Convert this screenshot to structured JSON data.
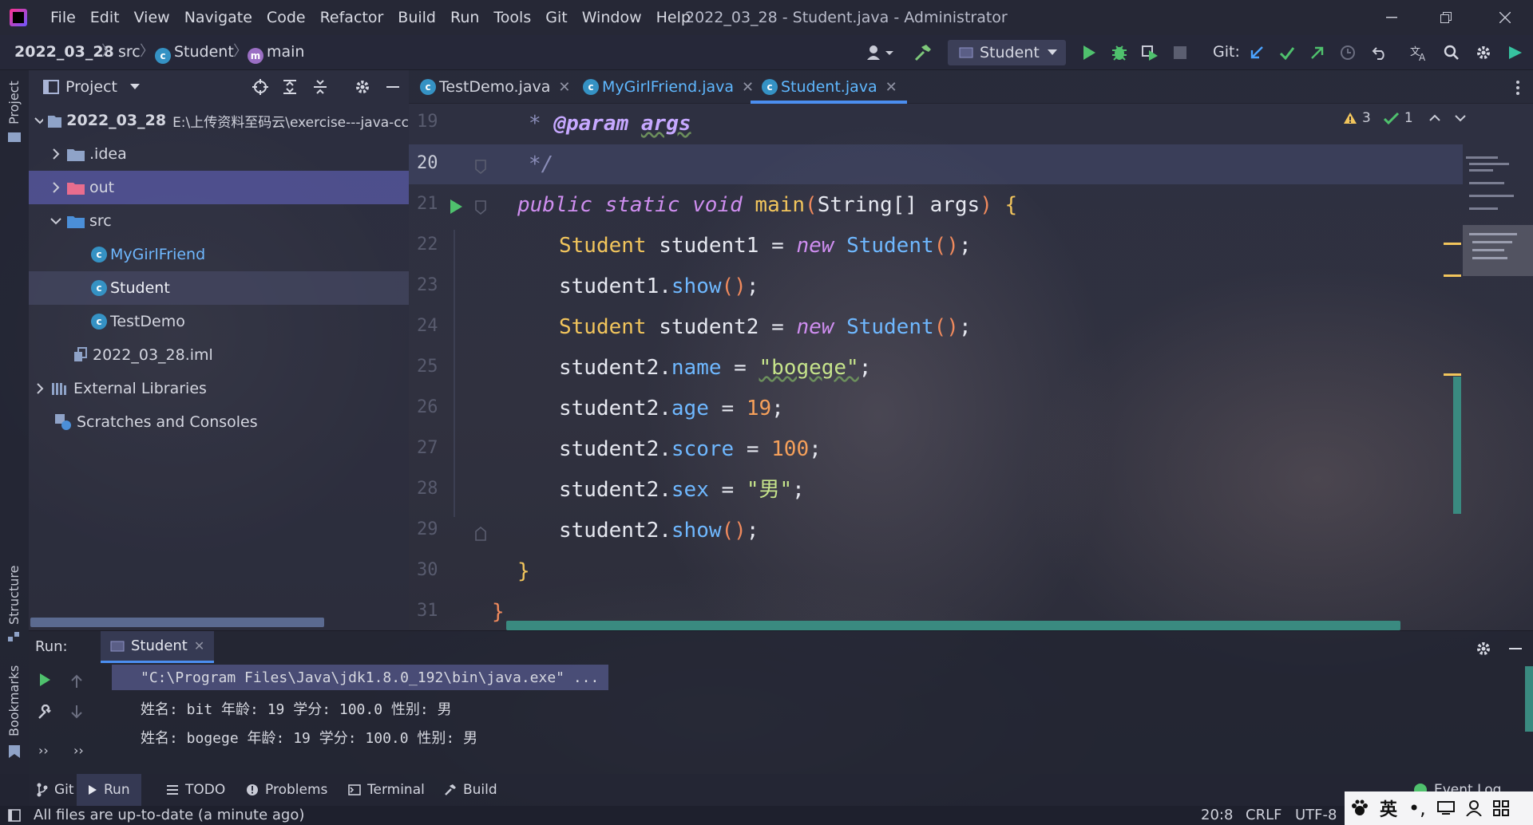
{
  "window": {
    "title": "2022_03_28 - Student.java - Administrator",
    "menu": [
      "File",
      "Edit",
      "View",
      "Navigate",
      "Code",
      "Refactor",
      "Build",
      "Run",
      "Tools",
      "Git",
      "Window",
      "Help"
    ]
  },
  "navbar": {
    "breadcrumb": {
      "project": "2022_03_28",
      "folder": "src",
      "class": "Student",
      "method": "main"
    },
    "run_config": "Student",
    "git_label": "Git:"
  },
  "side_stripe": {
    "project": "Project",
    "structure": "Structure",
    "bookmarks": "Bookmarks"
  },
  "project_panel": {
    "title": "Project",
    "tree": [
      {
        "label": "2022_03_28",
        "path": "E:\\上传资料至码云\\exercise---java-cc"
      },
      {
        "label": ".idea"
      },
      {
        "label": "out"
      },
      {
        "label": "src"
      },
      {
        "label": "MyGirlFriend"
      },
      {
        "label": "Student"
      },
      {
        "label": "TestDemo"
      },
      {
        "label": "2022_03_28.iml"
      },
      {
        "label": "External Libraries"
      },
      {
        "label": "Scratches and Consoles"
      }
    ]
  },
  "editor": {
    "tabs": [
      {
        "label": "TestDemo.java"
      },
      {
        "label": "MyGirlFriend.java"
      },
      {
        "label": "Student.java"
      }
    ],
    "inspection": {
      "warnings": "3",
      "ok": "1"
    },
    "line_numbers": [
      "19",
      "20",
      "21",
      "22",
      "23",
      "24",
      "25",
      "26",
      "27",
      "28",
      "29",
      "30",
      "31"
    ],
    "code": {
      "l19_star": "* ",
      "l19_tag": "@param",
      "l19_arg": "args",
      "l20": "*/",
      "l21_mods": "public static void",
      "l21_name": "main",
      "l21_sig": "String[] args",
      "l22_type": "Student",
      "l22_var": "student1",
      "l22_new": "new",
      "l22_cls": "Student",
      "l23_obj": "student1",
      "l23_m": "show",
      "l24_type": "Student",
      "l24_var": "student2",
      "l24_new": "new",
      "l24_cls": "Student",
      "l25_obj": "student2",
      "l25_f": "name",
      "l25_v": "\"bogege\"",
      "l26_obj": "student2",
      "l26_f": "age",
      "l26_v": "19",
      "l27_obj": "student2",
      "l27_f": "score",
      "l27_v": "100",
      "l28_obj": "student2",
      "l28_f": "sex",
      "l28_v": "\"男\"",
      "l29_obj": "student2",
      "l29_m": "show",
      "l30": "}",
      "l31": "}"
    }
  },
  "run_panel": {
    "label": "Run:",
    "tab": "Student",
    "output": [
      "\"C:\\Program Files\\Java\\jdk1.8.0_192\\bin\\java.exe\" ...",
      "姓名: bit 年龄: 19 学分: 100.0 性别: 男",
      "姓名: bogege 年龄: 19 学分: 100.0 性别: 男"
    ]
  },
  "bottom_tabs": [
    "Git",
    "Run",
    "TODO",
    "Problems",
    "Terminal",
    "Build",
    "Event Log"
  ],
  "statusbar": {
    "message": "All files are up-to-date (a minute ago)",
    "position": "20:8",
    "line_sep": "CRLF",
    "encoding": "UTF-8",
    "ime": "英"
  }
}
